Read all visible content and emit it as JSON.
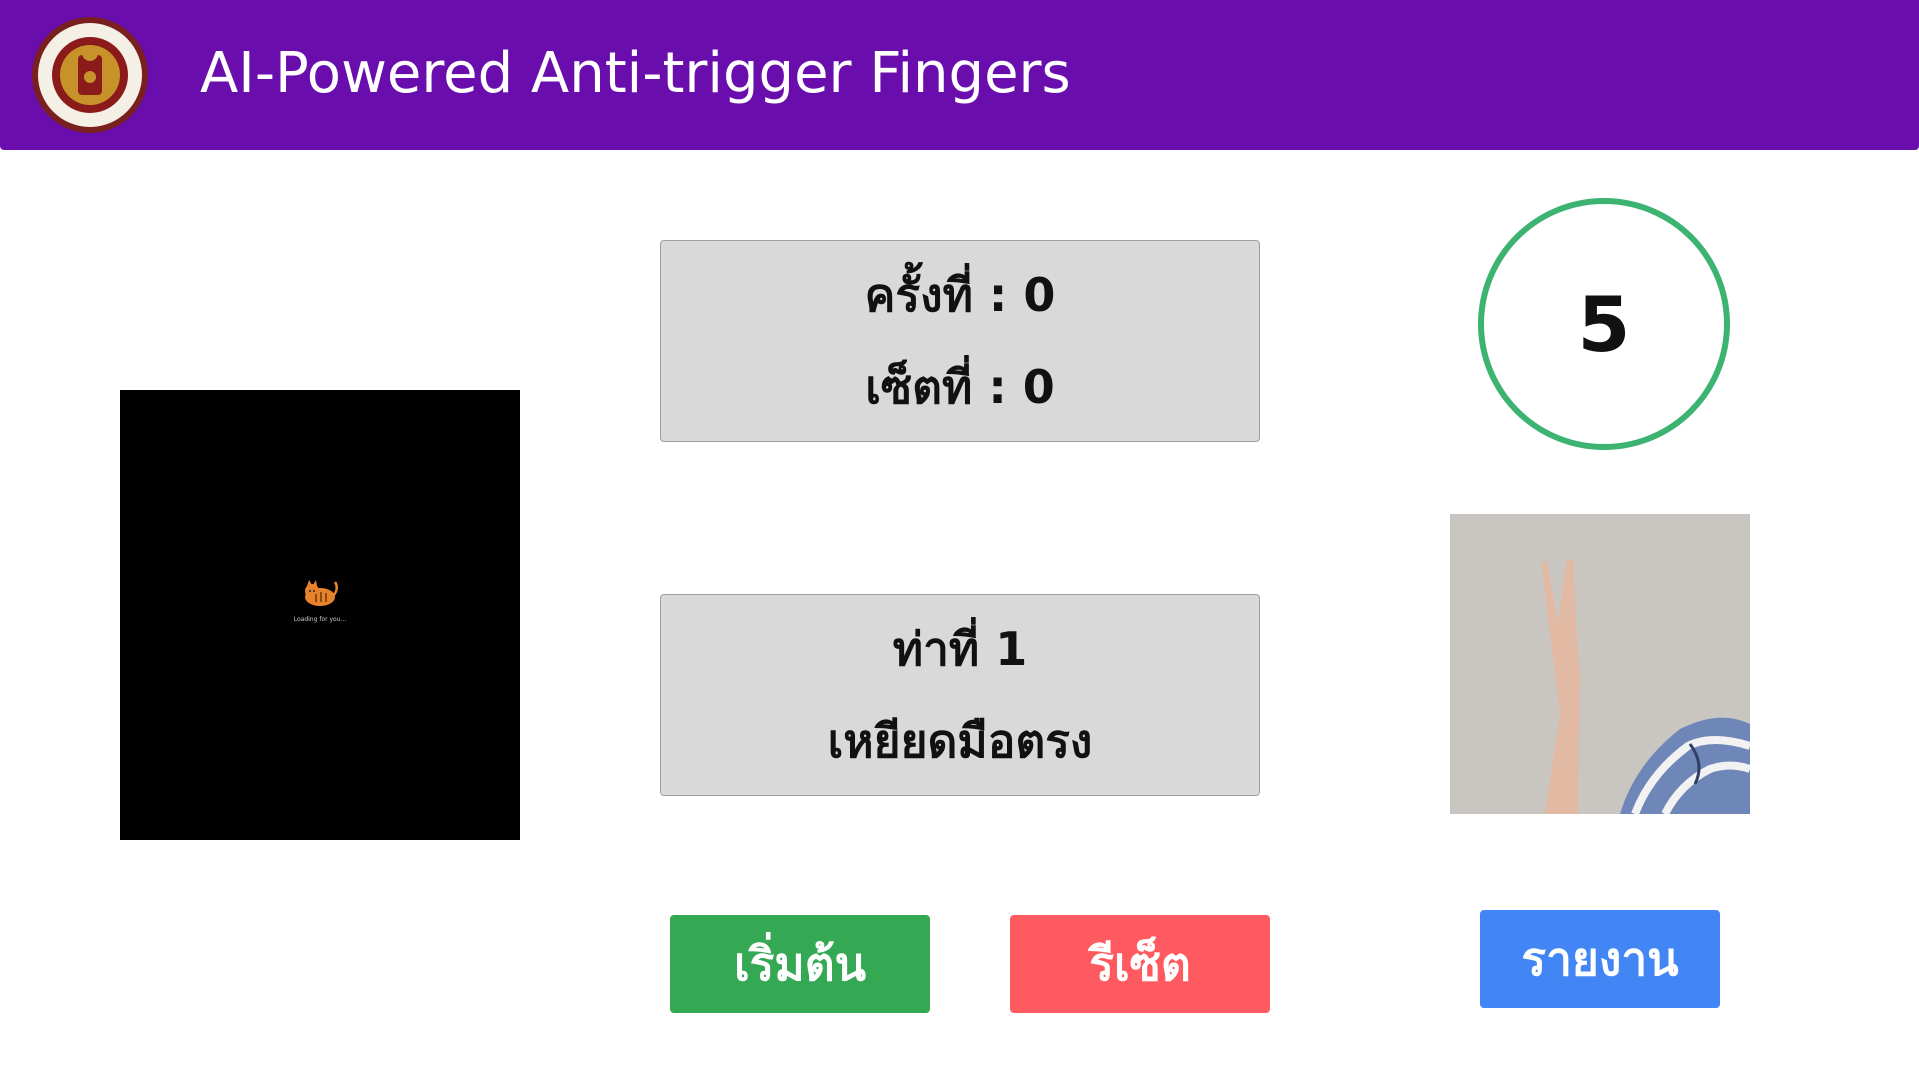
{
  "header": {
    "title": "AI-Powered Anti-trigger Fingers",
    "logo_text_top": "วิทยาลัยเทคนิคหาดใหญ่",
    "logo_text_bottom": "HATYAI TECHNICAL COLLEGE",
    "background_color": "#6a0dad"
  },
  "camera": {
    "loading_text": "Loading for you..."
  },
  "counter": {
    "rep_label": "ครั้งที่ : 0",
    "set_label": "เซ็ตที่ : 0"
  },
  "pose": {
    "number_label": "ท่าที่ 1",
    "name": "เหยียดมือตรง"
  },
  "timer": {
    "value": "5",
    "ring_color": "#3cb371"
  },
  "buttons": {
    "start": "เริ่มต้น",
    "reset": "รีเซ็ต",
    "report": "รายงาน"
  },
  "colors": {
    "start": "#34a853",
    "reset": "#ff5a5f",
    "report": "#4285f4"
  }
}
